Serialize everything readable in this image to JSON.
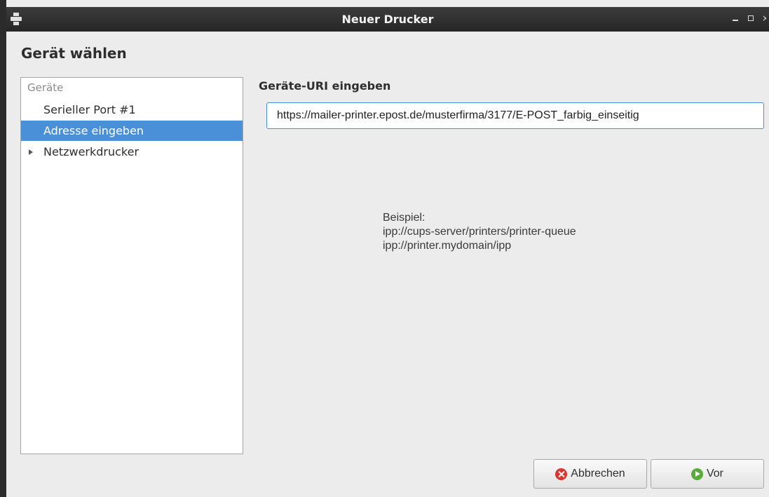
{
  "window": {
    "title": "Neuer Drucker"
  },
  "page": {
    "heading": "Gerät wählen"
  },
  "device_list": {
    "header": "Geräte",
    "items": [
      {
        "label": "Serieller Port #1",
        "selected": false,
        "expandable": false
      },
      {
        "label": "Adresse eingeben",
        "selected": true,
        "expandable": false
      },
      {
        "label": "Netzwerkdrucker",
        "selected": false,
        "expandable": true
      }
    ]
  },
  "uri": {
    "label": "Geräte-URI eingeben",
    "value": "https://mailer-printer.epost.de/musterfirma/3177/E-POST_farbig_einseitig"
  },
  "example": {
    "label": "Beispiel:",
    "lines": [
      "ipp://cups-server/printers/printer-queue",
      "ipp://printer.mydomain/ipp"
    ]
  },
  "buttons": {
    "cancel": "Abbrechen",
    "next": "Vor"
  },
  "colors": {
    "selection": "#4a90d9",
    "cancel_icon": "#d9362f",
    "next_icon": "#5bab3a"
  }
}
